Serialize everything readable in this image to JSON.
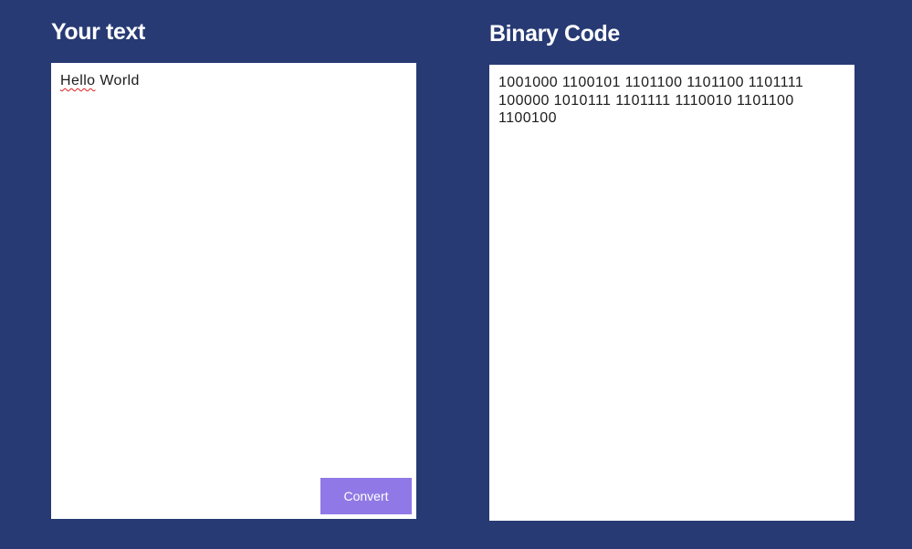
{
  "input_section": {
    "title": "Your text",
    "text_first_word": "Hello",
    "text_rest": " World",
    "convert_label": "Convert"
  },
  "output_section": {
    "title": "Binary Code",
    "binary": "1001000 1100101 1101100 1101100 1101111 100000 1010111 1101111 1110010 1101100 1100100"
  },
  "colors": {
    "background": "#273a74",
    "panel": "#ffffff",
    "button": "#9079e6",
    "text": "#1c1c1c",
    "spellcheck_underline": "#e02020"
  }
}
